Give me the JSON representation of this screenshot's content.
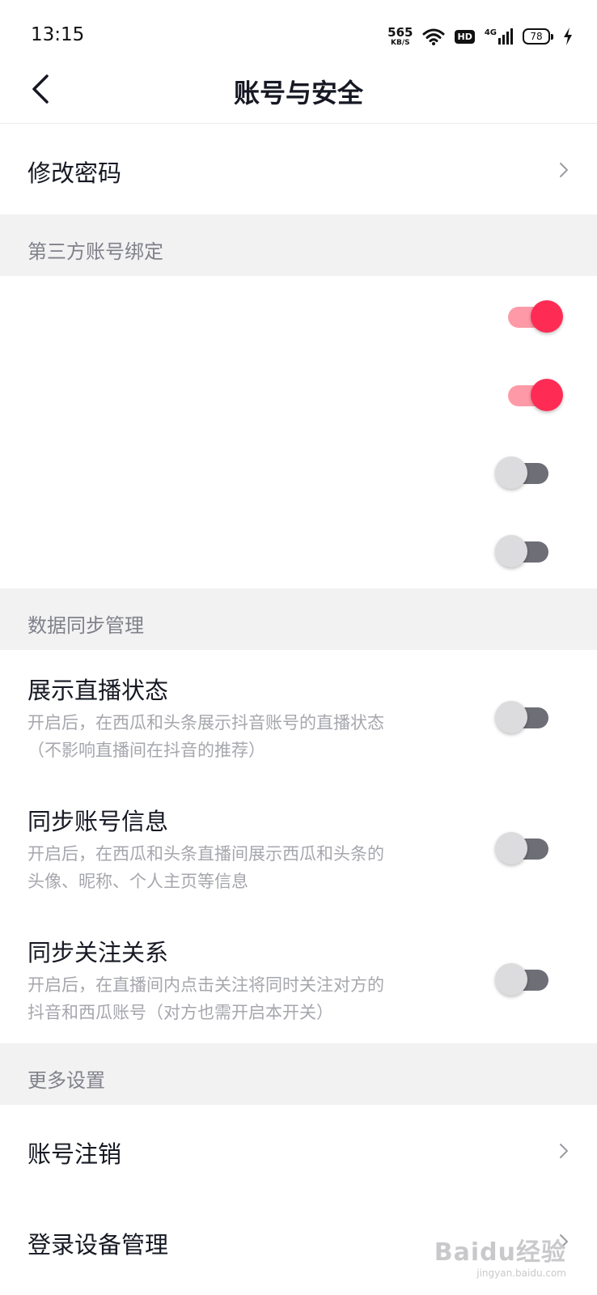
{
  "status_bar": {
    "time": "13:15",
    "net_speed": "565",
    "net_speed_unit": "KB/S",
    "hd_label": "HD",
    "network_gen": "4G",
    "battery": "78"
  },
  "header": {
    "title": "账号与安全"
  },
  "change_password": {
    "label": "修改密码"
  },
  "sections": {
    "third_party": "第三方账号绑定",
    "data_sync": "数据同步管理",
    "more": "更多设置"
  },
  "third_party_toggles": [
    {
      "state": "on"
    },
    {
      "state": "on"
    },
    {
      "state": "off"
    },
    {
      "state": "off"
    }
  ],
  "sync_items": [
    {
      "title": "展示直播状态",
      "desc_line1": "开启后，在西瓜和头条展示抖音账号的直播状态",
      "desc_line2": "（不影响直播间在抖音的推荐）",
      "state": "off"
    },
    {
      "title": "同步账号信息",
      "desc_line1": "开启后，在西瓜和头条直播间展示西瓜和头条的",
      "desc_line2": "头像、昵称、个人主页等信息",
      "state": "off"
    },
    {
      "title": "同步关注关系",
      "desc_line1": "开启后，在直播间内点击关注将同时关注对方的",
      "desc_line2": "抖音和西瓜账号（对方也需开启本开关）",
      "state": "off"
    }
  ],
  "more_items": [
    {
      "label": "账号注销"
    },
    {
      "label": "登录设备管理"
    }
  ],
  "watermark": {
    "main": "Baidu经验",
    "sub": "jingyan.baidu.com"
  },
  "colors": {
    "accent": "#fe2c55",
    "accent_track": "#fe9aa7",
    "off_track": "#6d6e76",
    "section_bg": "#f2f2f3"
  }
}
